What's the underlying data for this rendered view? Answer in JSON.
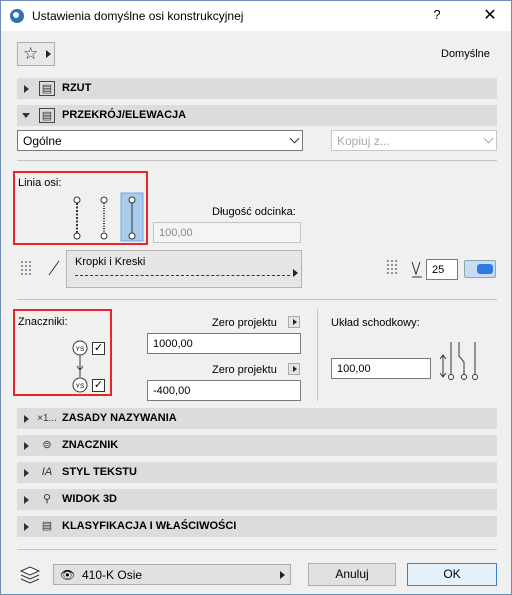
{
  "window": {
    "title": "Ustawienia domyślne osi konstrukcyjnej",
    "help_label": "?",
    "close_label": "✕"
  },
  "header": {
    "favorites_icon": "star-icon",
    "default_label": "Domyślne"
  },
  "sections": {
    "rzut": "RZUT",
    "przekroj": "PRZEKRÓJ/ELEWACJA",
    "zasady": "ZASADY NAZYWANIA",
    "zasady_icon_text": "×1...",
    "znacznik": "ZNACZNIK",
    "styl": "STYL TEKSTU",
    "widok": "WIDOK 3D",
    "klasyfikacja": "KLASYFIKACJA I WŁAŚCIWOŚCI"
  },
  "selectors": {
    "view_value": "Ogólne",
    "copy_placeholder": "Kopiuj z..."
  },
  "axis_line": {
    "label": "Linia osi:",
    "segment_label": "Długość odcinka:",
    "segment_value": "100,00",
    "line_type": "Kropki i Kreski",
    "pen_value": "25"
  },
  "markers": {
    "label": "Znaczniki:",
    "top_checked": true,
    "bottom_checked": true,
    "marker_text": "YS",
    "zero1_label": "Zero projektu",
    "zero1_value": "1000,00",
    "zero2_label": "Zero projektu",
    "zero2_value": "-400,00",
    "stagger_label": "Układ schodkowy:",
    "stagger_value": "100,00"
  },
  "footer": {
    "layer_value": "410-K Osie",
    "cancel_label": "Anuluj",
    "ok_label": "OK"
  },
  "colors": {
    "highlight_frame": "#e5262b",
    "selected_option": "#a8cbee",
    "accent_blue": "#2f7ae5"
  }
}
